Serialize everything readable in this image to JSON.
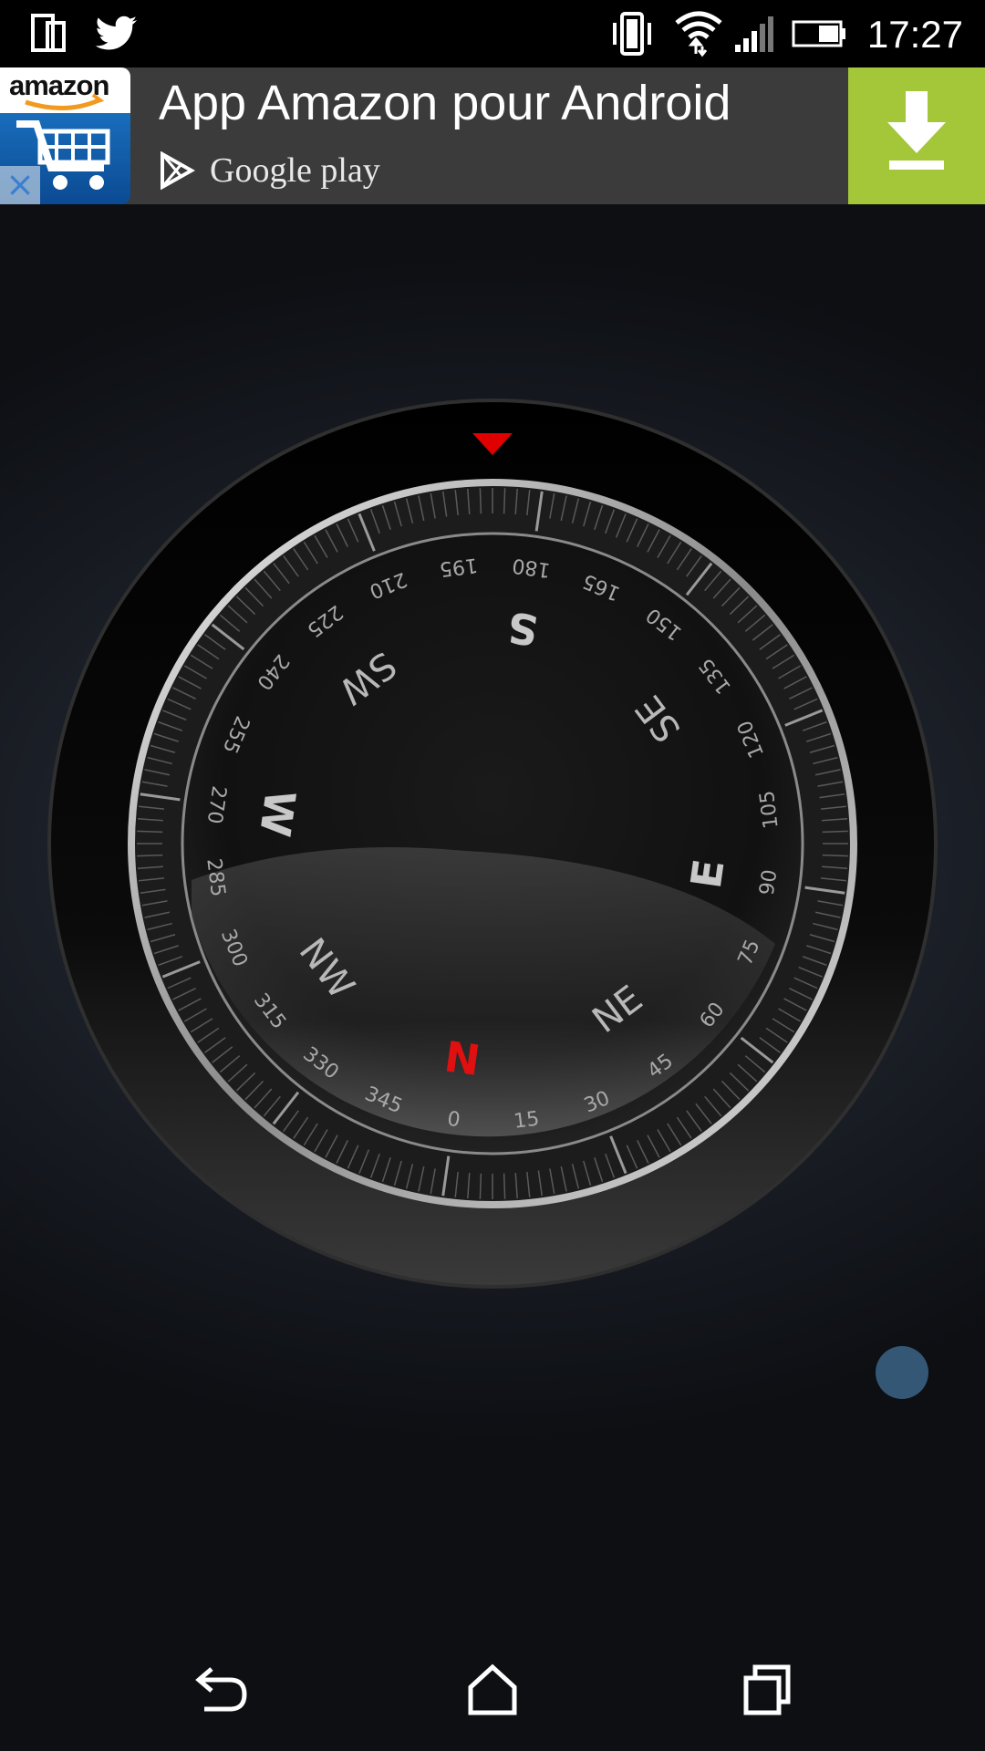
{
  "status_bar": {
    "time": "17:27",
    "left_icons": [
      "notification-icon",
      "twitter-icon"
    ],
    "right_icons": [
      "vibrate-icon",
      "wifi-icon",
      "signal-icon",
      "battery-icon"
    ]
  },
  "ad_banner": {
    "logo_text": "amazon",
    "title": "App Amazon pour Android",
    "store_label": "Google play",
    "close_icon": "close-icon",
    "download_icon": "download-icon",
    "accent_color": "#a4c639"
  },
  "compass": {
    "heading_marker_color": "#e00000",
    "north_color": "#e01010",
    "cardinals": {
      "N": "N",
      "E": "E",
      "S": "S",
      "W": "W"
    },
    "intercardinals": {
      "NE": "NE",
      "SE": "SE",
      "SW": "SW",
      "NW": "NW"
    },
    "degree_labels": [
      "0",
      "15",
      "30",
      "45",
      "60",
      "75",
      "90",
      "105",
      "120",
      "135",
      "150",
      "165",
      "180",
      "195",
      "210",
      "225",
      "240",
      "255",
      "270",
      "285",
      "300",
      "315",
      "330",
      "345"
    ]
  },
  "nav_bar": {
    "icons": [
      "back-icon",
      "home-icon",
      "recents-icon"
    ]
  }
}
